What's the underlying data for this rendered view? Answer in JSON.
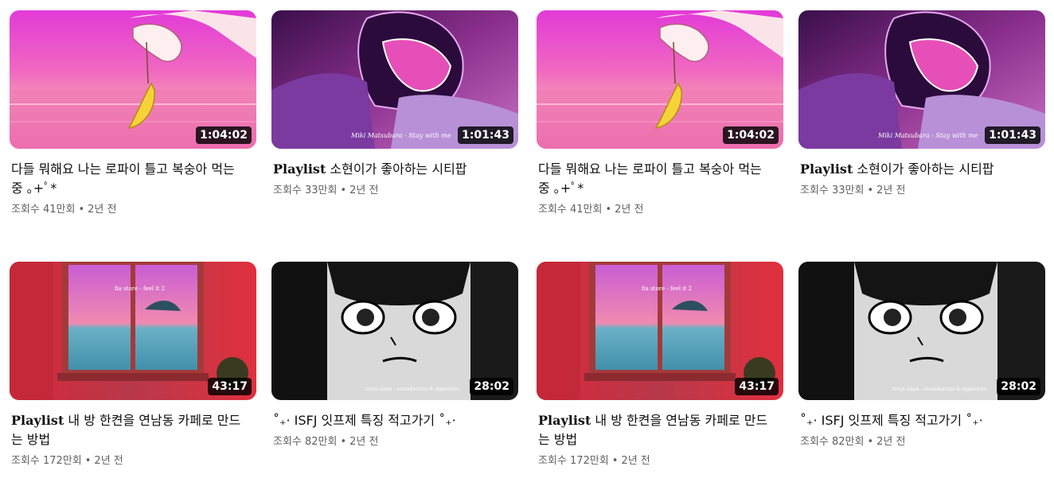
{
  "videos": [
    {
      "title_prefix": "",
      "title": "다들 뭐해요 나는 로파이 틀고 복숭아 먹는 중 ｡+ﾟ*",
      "duration": "1:04:02",
      "views": "조회수 41만회",
      "age": "2년 전",
      "thumb": "moon-pink"
    },
    {
      "title_prefix": "Playlist",
      "title": " 소현이가 좋아하는 시티팝",
      "duration": "1:01:43",
      "views": "조회수 33만회",
      "age": "2년 전",
      "thumb": "helmet-purple"
    },
    {
      "title_prefix": "",
      "title": "다들 뭐해요 나는 로파이 틀고 복숭아 먹는 중 ｡+ﾟ*",
      "duration": "1:04:02",
      "views": "조회수 41만회",
      "age": "2년 전",
      "thumb": "moon-pink"
    },
    {
      "title_prefix": "Playlist",
      "title": " 소현이가 좋아하는 시티팝",
      "duration": "1:01:43",
      "views": "조회수 33만회",
      "age": "2년 전",
      "thumb": "helmet-purple"
    },
    {
      "title_prefix": "Playlist",
      "title": " 내 방 한켠을 연남동 카페로 만드는 방법",
      "duration": "43:17",
      "views": "조회수 172만회",
      "age": "2년 전",
      "thumb": "window-sea"
    },
    {
      "title_prefix": "",
      "title": "˚₊· ISFJ 잇프제 특징 적고가기 ˚₊·",
      "duration": "28:02",
      "views": "조회수 82만회",
      "age": "2년 전",
      "thumb": "manga-girl"
    },
    {
      "title_prefix": "Playlist",
      "title": " 내 방 한켠을 연남동 카페로 만드는 방법",
      "duration": "43:17",
      "views": "조회수 172만회",
      "age": "2년 전",
      "thumb": "window-sea"
    },
    {
      "title_prefix": "",
      "title": "˚₊· ISFJ 잇프제 특징 적고가기 ˚₊·",
      "duration": "28:02",
      "views": "조회수 82만회",
      "age": "2년 전",
      "thumb": "manga-girl"
    }
  ],
  "thumb_text": {
    "helmet": "Miki Matsubara - Stay with me",
    "window": "fia store - feel it 2",
    "manga": "troye sivan - strawberries & cigarettes"
  },
  "separator": "•"
}
